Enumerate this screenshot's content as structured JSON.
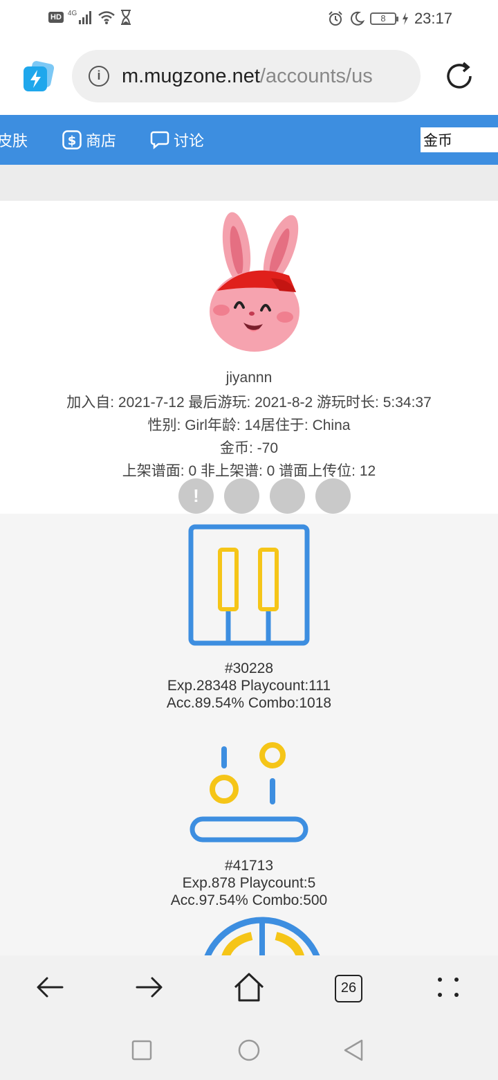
{
  "status_bar": {
    "hd": "HD",
    "network": "4G",
    "battery": "8",
    "time": "23:17"
  },
  "browser": {
    "url_host": "m.mugzone.net",
    "url_path": "/accounts/us",
    "tab_count": "26"
  },
  "nav": {
    "items": [
      {
        "label": "皮肤",
        "icon": "skin-icon"
      },
      {
        "label": "商店",
        "icon": "dollar-icon"
      },
      {
        "label": "讨论",
        "icon": "chat-bubble-icon"
      }
    ],
    "search_value": "金币"
  },
  "profile": {
    "username": "jiyannn",
    "line1": "加入自: 2021-7-12 最后游玩: 2021-8-2 游玩时长: 5:34:37",
    "line2": "性别: Girl年龄: 14居住于: China",
    "line3": "金币: -70",
    "line4": "上架谱面: 0 非上架谱: 0 谱面上传位: 12",
    "badge_first": "!"
  },
  "songs": [
    {
      "id": "#30228",
      "stats1": "Exp.28348 Playcount:111",
      "stats2": "Acc.89.54% Combo:1018",
      "icon": "piano-keys-icon"
    },
    {
      "id": "#41713",
      "stats1": "Exp.878 Playcount:5",
      "stats2": "Acc.97.54% Combo:500",
      "icon": "falling-notes-icon"
    }
  ],
  "colors": {
    "nav_blue": "#3d8ee0",
    "accent_yellow": "#f5c518",
    "icon_blue": "#3d8ee0"
  }
}
